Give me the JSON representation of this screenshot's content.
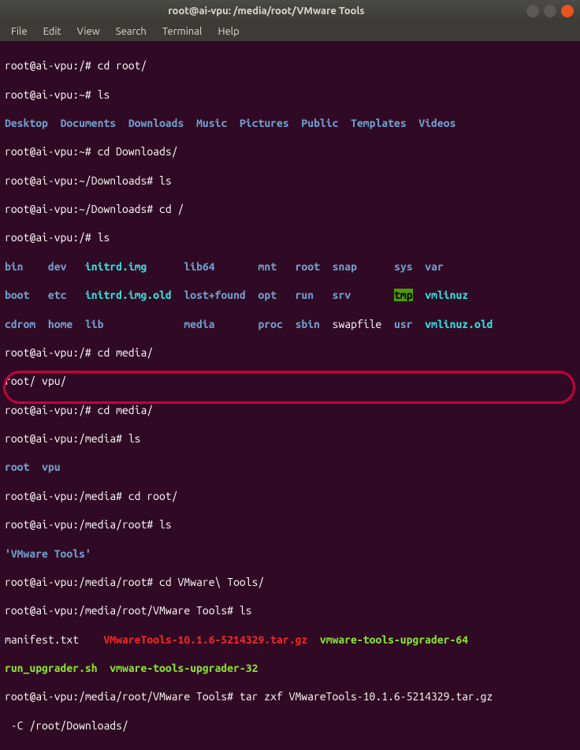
{
  "titlebar": {
    "title": "root@ai-vpu: /media/root/VMware Tools"
  },
  "menubar": {
    "items": [
      "File",
      "Edit",
      "View",
      "Search",
      "Terminal",
      "Help"
    ]
  },
  "lines": {
    "l1_prompt": "root@ai-vpu:/# ",
    "l1_cmd": "cd root/",
    "l2_prompt": "root@ai-vpu:~# ",
    "l2_cmd": "ls",
    "l3_items": [
      "Desktop",
      "Documents",
      "Downloads",
      "Music",
      "Pictures",
      "Public",
      "Templates",
      "Videos"
    ],
    "l4_prompt": "root@ai-vpu:~# ",
    "l4_cmd": "cd Downloads/",
    "l5_prompt": "root@ai-vpu:~/Downloads# ",
    "l5_cmd": "ls",
    "l6_prompt": "root@ai-vpu:~/Downloads# ",
    "l6_cmd": "cd /",
    "l7_prompt": "root@ai-vpu:/# ",
    "l7_cmd": "ls",
    "r1_bin": "bin",
    "r1_dev": "dev",
    "r1_initrd": "initrd.img",
    "r1_lib64": "lib64",
    "r1_mnt": "mnt",
    "r1_root": "root",
    "r1_snap": "snap",
    "r1_sys": "sys",
    "r1_var": "var",
    "r2_boot": "boot",
    "r2_etc": "etc",
    "r2_initrdold": "initrd.img.old",
    "r2_lostfound": "lost+found",
    "r2_opt": "opt",
    "r2_run": "run",
    "r2_srv": "srv",
    "r2_tmp": "tmp",
    "r2_vmlinuz": "vmlinuz",
    "r3_cdrom": "cdrom",
    "r3_home": "home",
    "r3_lib": "lib",
    "r3_media": "media",
    "r3_proc": "proc",
    "r3_sbin": "sbin",
    "r3_swapfile": "swapfile",
    "r3_usr": "usr",
    "r3_vmlinuzold": "vmlinuz.old",
    "l11_prompt": "root@ai-vpu:/# ",
    "l11_cmd": "cd media/",
    "l12": "root/ vpu/",
    "l13_prompt": "root@ai-vpu:/# ",
    "l13_cmd": "cd media/",
    "l14_prompt": "root@ai-vpu:/media# ",
    "l14_cmd": "ls",
    "l15_root": "root",
    "l15_vpu": "vpu",
    "l16_prompt": "root@ai-vpu:/media# ",
    "l16_cmd": "cd root/",
    "l17_prompt": "root@ai-vpu:/media/root# ",
    "l17_cmd": "ls",
    "l18": "'VMware Tools'",
    "l19_prompt": "root@ai-vpu:/media/root# ",
    "l19_cmd": "cd VMware\\ Tools/",
    "l20_prompt": "root@ai-vpu:/media/root/VMware Tools# ",
    "l20_cmd": "ls",
    "l21_manifest": "manifest.txt",
    "l21_tar": "VMwareTools-10.1.6-5214329.tar.gz",
    "l21_upg64": "vmware-tools-upgrader-64",
    "l22_runsh": "run_upgrader.sh",
    "l22_upg32": "vmware-tools-upgrader-32",
    "l23_prompt": "root@ai-vpu:/media/root/VMware Tools# ",
    "l23_cmd": "tar zxf VMwareTools-10.1.6-5214329.tar.gz",
    "l24": " -C /root/Downloads/"
  }
}
